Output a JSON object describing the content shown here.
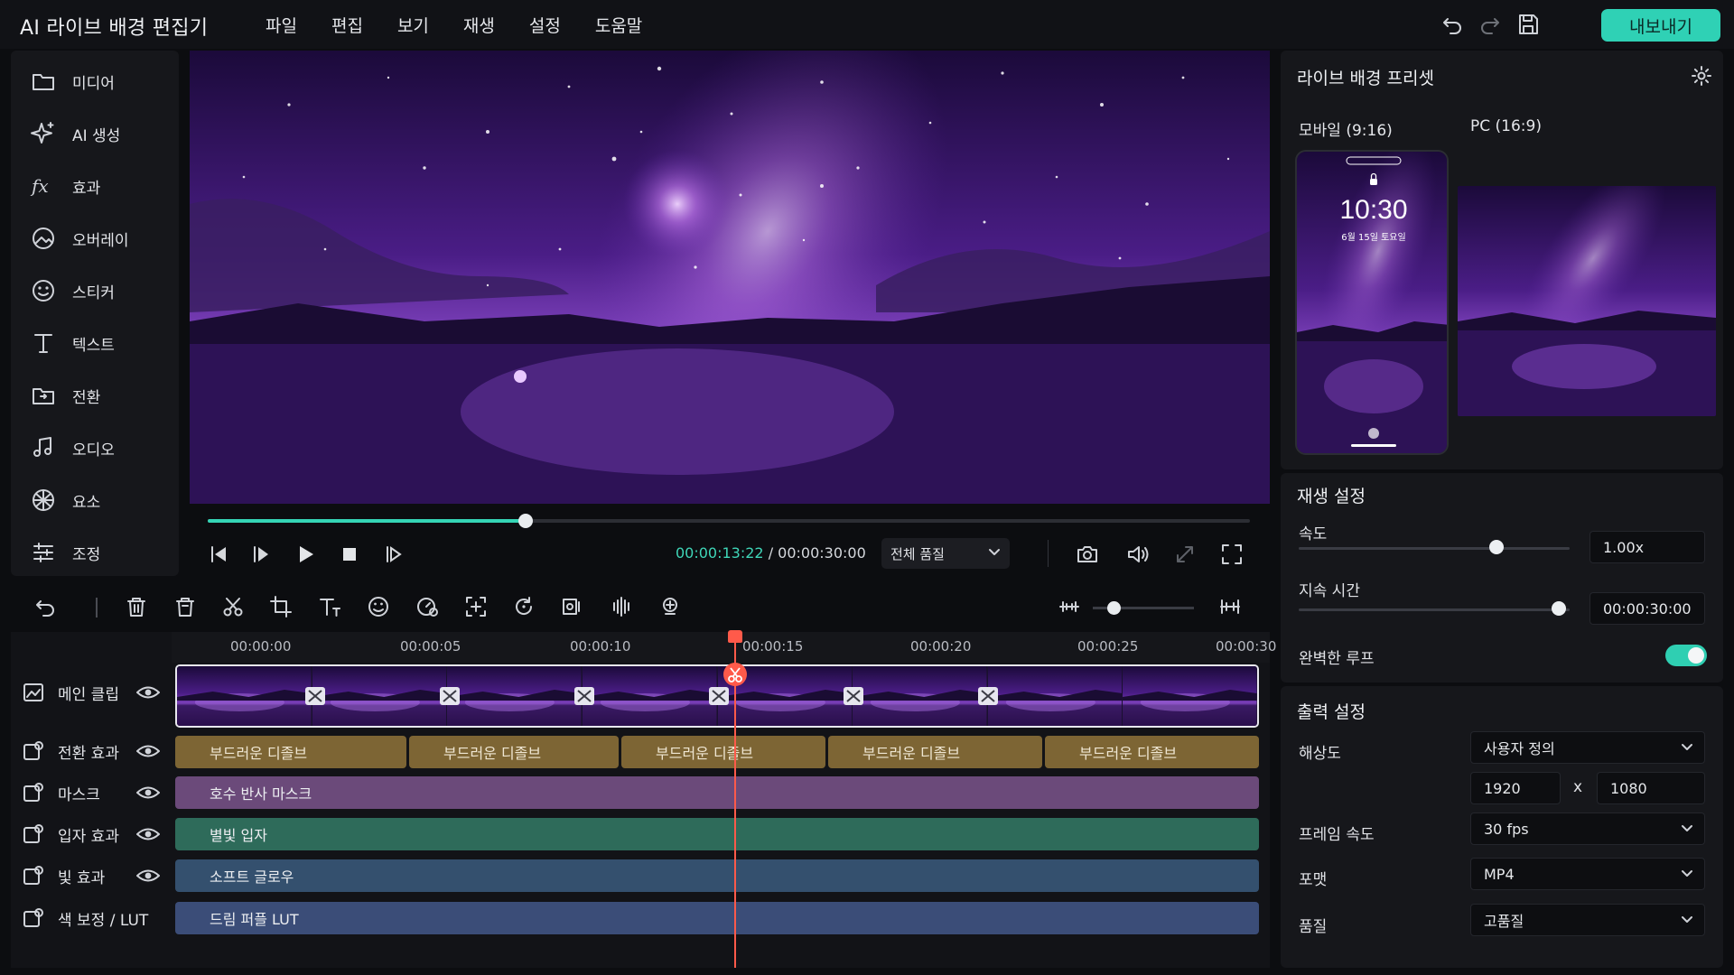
{
  "app": {
    "title": "AI 라이브 배경 편집기"
  },
  "menu": [
    "파일",
    "편집",
    "보기",
    "재생",
    "설정",
    "도움말"
  ],
  "toolbar": {
    "export_label": "내보내기"
  },
  "sidebar": {
    "items": [
      {
        "label": "미디어",
        "icon": "folder-icon"
      },
      {
        "label": "AI 생성",
        "icon": "sparkle-icon"
      },
      {
        "label": "효과",
        "icon": "fx-icon"
      },
      {
        "label": "오버레이",
        "icon": "overlay-icon"
      },
      {
        "label": "스티커",
        "icon": "sticker-icon"
      },
      {
        "label": "텍스트",
        "icon": "text-icon"
      },
      {
        "label": "전환",
        "icon": "transition-icon"
      },
      {
        "label": "오디오",
        "icon": "music-note-icon"
      },
      {
        "label": "요소",
        "icon": "elements-icon"
      },
      {
        "label": "조정",
        "icon": "adjust-icon"
      }
    ]
  },
  "player": {
    "current_time": "00:00:13:22",
    "separator": " / ",
    "total_time": "00:00:30:00",
    "progress": 0.305,
    "quality": "전체 품질"
  },
  "timeline": {
    "ruler": [
      "00:00:00",
      "00:00:05",
      "00:00:10",
      "00:00:15",
      "00:00:20",
      "00:00:25",
      "00:00:30"
    ],
    "playhead_seconds": 14.8,
    "tracks": [
      {
        "label": "메인 클립"
      },
      {
        "label": "전환 효과"
      },
      {
        "label": "마스크"
      },
      {
        "label": "입자 효과"
      },
      {
        "label": "빛 효과"
      },
      {
        "label": "색 보정 / LUT"
      }
    ],
    "transitions": [
      "부드러운 디졸브",
      "부드러운 디졸브",
      "부드러운 디졸브",
      "부드러운 디졸브",
      "부드러운 디졸브"
    ],
    "mask_clip": "호수 반사 마스크",
    "particle_clip": "별빛 입자",
    "light_clip": "소프트 글로우",
    "lut_clip": "드림 퍼플 LUT"
  },
  "presets": {
    "title": "라이브 배경 프리셋",
    "tab_mobile": "모바일 (9:16)",
    "tab_pc": "PC (16:9)",
    "phone_time": "10:30",
    "phone_date": "6월 15일 토요일"
  },
  "playback": {
    "title": "재생 설정",
    "speed_label": "속도",
    "speed_value": "1.00x",
    "speed_level": 0.73,
    "duration_label": "지속 시간",
    "duration_value": "00:00:30:00",
    "duration_level": 1.0,
    "loop_label": "완벽한 루프",
    "loop_on": true
  },
  "output": {
    "title": "출력 설정",
    "resolution_label": "해상도",
    "resolution_value": "사용자 정의",
    "width": "1920",
    "x": "x",
    "height": "1080",
    "framerate_label": "프레임 속도",
    "framerate_value": "30 fps",
    "format_label": "포맷",
    "format_value": "MP4",
    "quality_label": "품질",
    "quality_value": "고품질"
  },
  "colors": {
    "accent": "#2fd1b5",
    "playhead": "#ff5a4a",
    "transition": "#7d6534",
    "mask": "#6b4a7a",
    "particle": "#2e6b5a",
    "light": "#34506e",
    "lut": "#3b4d78"
  }
}
